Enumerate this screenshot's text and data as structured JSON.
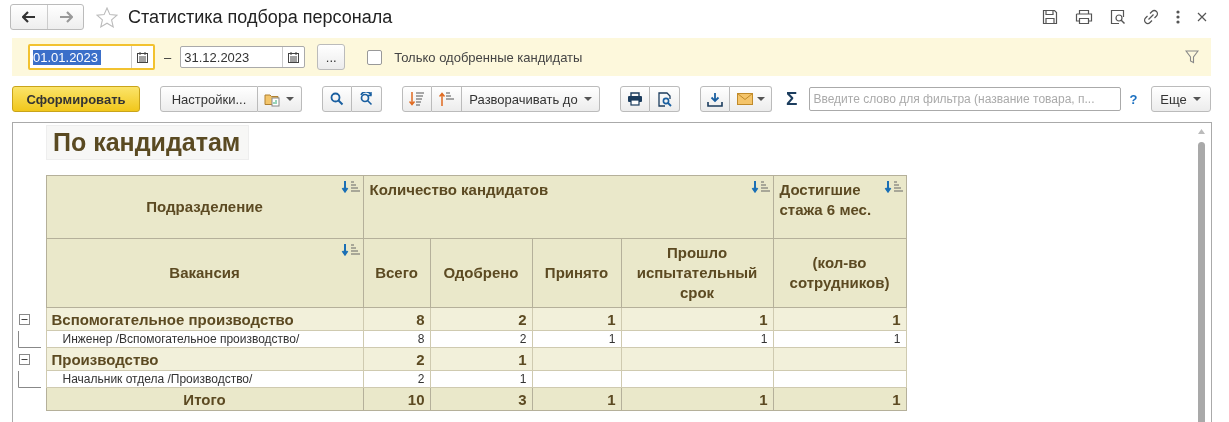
{
  "window": {
    "title": "Статистика подбора персонала"
  },
  "filter": {
    "date_from": {
      "value": "01.01.2023",
      "focused": true
    },
    "date_to": {
      "value": "31.12.2023",
      "focused": false
    },
    "dash": "–",
    "more_button": "...",
    "approved_only": {
      "label": "Только одобренные кандидаты",
      "checked": false
    }
  },
  "toolbar": {
    "generate": "Сформировать",
    "settings": "Настройки...",
    "expand_to": "Разворачивать до",
    "sum_symbol": "Σ",
    "search": {
      "placeholder": "Введите слово для фильтра (название товара, п..."
    },
    "help": "?",
    "more": "Еще"
  },
  "report": {
    "title": "По кандидатам",
    "header_top": [
      {
        "text": "Подразделение",
        "sort_icon": true
      },
      {
        "text": "Количество кандидатов",
        "sort_icon": true
      },
      {
        "text": "Достигшие стажа 6 мес.",
        "sort_icon": true
      }
    ],
    "header_bottom": [
      {
        "text": "Вакансия",
        "sort_icon": true
      },
      {
        "text": "Всего",
        "sort_icon": false
      },
      {
        "text": "Одобрено",
        "sort_icon": false
      },
      {
        "text": "Принято",
        "sort_icon": false
      },
      {
        "text": "Прошло испытательный срок",
        "sort_icon": false
      },
      {
        "text": "(кол-во сотрудников)",
        "sort_icon": false
      }
    ],
    "groups": [
      {
        "label": "Вспомогательное производство",
        "expanded": true,
        "values": [
          "8",
          "2",
          "1",
          "1",
          "1"
        ],
        "children": [
          {
            "label": "Инженер /Вспомогательное производство/",
            "values": [
              "8",
              "2",
              "1",
              "1",
              "1"
            ]
          }
        ]
      },
      {
        "label": "Производство",
        "expanded": true,
        "values": [
          "2",
          "1"
        ],
        "children": [
          {
            "label": "Начальник отдела /Производство/",
            "values": [
              "2",
              "1"
            ]
          }
        ]
      }
    ],
    "total": {
      "label": "Итого",
      "values": [
        "10",
        "3",
        "1",
        "1",
        "1"
      ]
    }
  }
}
